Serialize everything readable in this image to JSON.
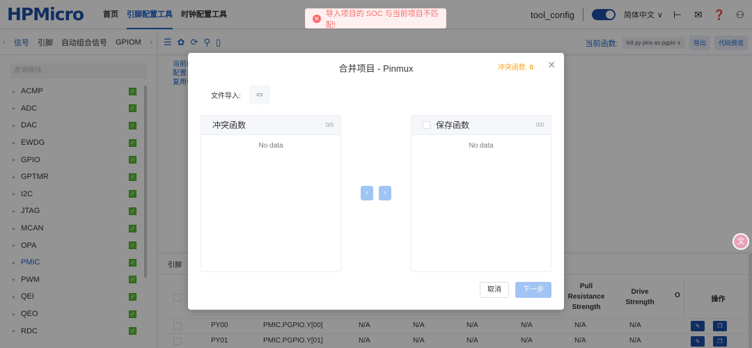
{
  "header": {
    "logo": "HPMicro",
    "nav": [
      "首页",
      "引脚配置工具",
      "时钟配置工具"
    ],
    "active_nav": 1,
    "tool_config": "tool_config",
    "language": "简体中文",
    "lang_caret": "∨",
    "icons": [
      "theme-toggle-icon",
      "git-branch-icon",
      "mail-icon",
      "help-icon",
      "user-icon"
    ]
  },
  "toast": {
    "message": "导入项目的 SOC 与当前项目不匹配!",
    "icon": "error-circle-icon",
    "color": "#f56c6c"
  },
  "left": {
    "tabs": [
      "信号",
      "引脚",
      "自动组合信号",
      "GPIOM"
    ],
    "active_tab": 0,
    "search_placeholder": "查询模块",
    "items": [
      "ACMP",
      "ADC",
      "DAC",
      "EWDG",
      "GPIO",
      "GPTMR",
      "I2C",
      "JTAG",
      "MCAN",
      "OPA",
      "PMIC",
      "PWM",
      "QEI",
      "QEO",
      "RDC"
    ],
    "active_item": "PMIC"
  },
  "toolbar": {
    "current_func_label": "当前函数:",
    "current_func_value": "init py pins as pgpio ∨",
    "export_label": "导出",
    "preview_label": "代码预览"
  },
  "desc": {
    "lines": [
      "当前函",
      "配置共",
      "复用引"
    ]
  },
  "table": {
    "tab_label": "引脚",
    "headers": {
      "pull": "Pull Resistance Strength",
      "pull_lines": [
        "Pull",
        "Resistance",
        "Strength"
      ],
      "drive_lines": [
        "Drive",
        "Strength"
      ],
      "o": "O",
      "op": "操作"
    },
    "rows": [
      {
        "pin": "PY00",
        "signal": "PMIC.PGPIO.Y[00]",
        "c1": "N/A",
        "c2": "N/A",
        "c3": "N/A",
        "c4": "N/A",
        "c5": "N/A",
        "c6": "N/A"
      },
      {
        "pin": "PY01",
        "signal": "PMIC.PGPIO.Y[01]",
        "c1": "N/A",
        "c2": "N/A",
        "c3": "N/A",
        "c4": "N/A",
        "c5": "N/A",
        "c6": "N/A"
      }
    ]
  },
  "dialog": {
    "title": "合并项目 - Pinmux",
    "conflict_label": "冲突函数:",
    "conflict_count": "0",
    "file_import_label": "文件导入:",
    "left_panel": {
      "title": "冲突函数",
      "count": "0/0",
      "empty": "No data"
    },
    "right_panel": {
      "title": "保存函数",
      "count": "0/0",
      "empty": "No data"
    },
    "cancel_label": "取消",
    "next_label": "下一步"
  },
  "colors": {
    "brand": "#1e50a8",
    "accent": "#1e64c8",
    "warning": "#f5a623",
    "error": "#f56c6c",
    "disabled_primary": "#a0c4f4",
    "check_green": "#5fbf3a"
  }
}
